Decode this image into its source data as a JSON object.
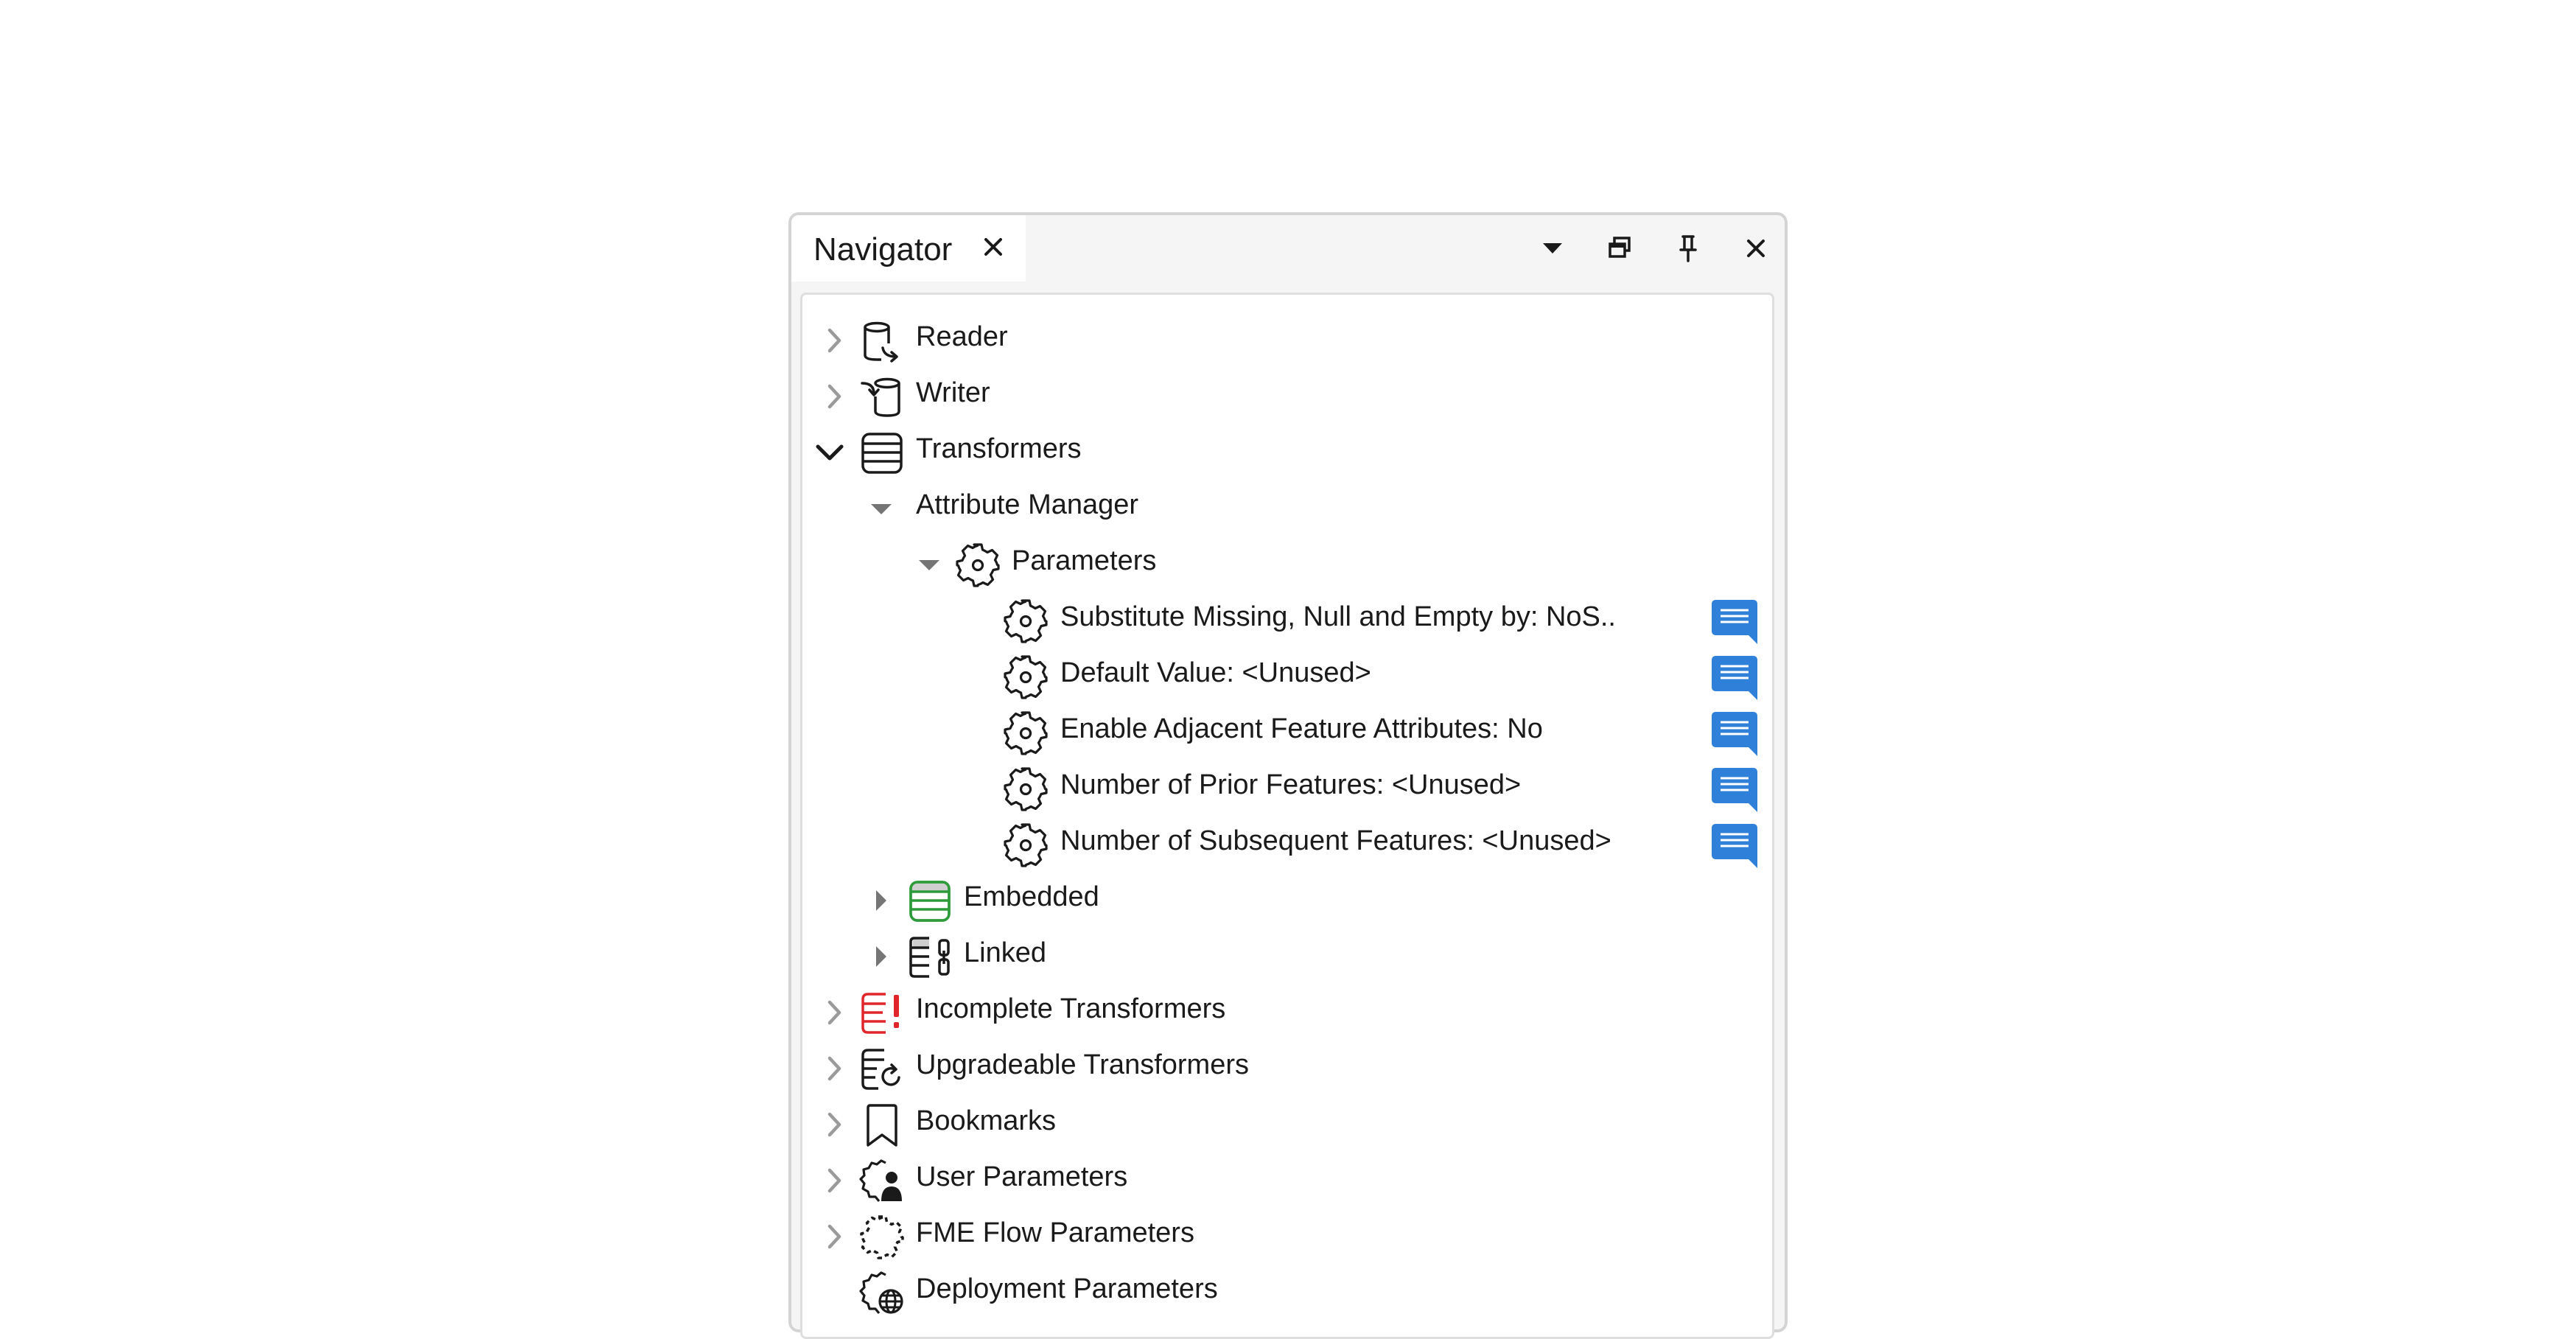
{
  "panel": {
    "tab_title": "Navigator",
    "toolbar": [
      "chevron-down-icon",
      "restore-icon",
      "pin-icon",
      "close-icon"
    ]
  },
  "tree": [
    {
      "label": "Reader",
      "icon": "reader-icon",
      "expander": "chevron-right",
      "expanded": false
    },
    {
      "label": "Writer",
      "icon": "writer-icon",
      "expander": "chevron-right",
      "expanded": false
    },
    {
      "label": "Transformers",
      "icon": "transformers-icon",
      "expander": "chevron-down",
      "expanded": true
    },
    {
      "label": "Attribute Manager",
      "expander": "triangle-down",
      "expanded": true
    },
    {
      "label": "Parameters",
      "icon": "gear-icon",
      "expander": "triangle-down",
      "expanded": true
    },
    {
      "label": "Substitute Missing, Null and Empty by: NoS..",
      "icon": "gear-icon",
      "annotation": "note-icon"
    },
    {
      "label": "Default Value: <Unused>",
      "icon": "gear-icon",
      "annotation": "note-icon"
    },
    {
      "label": "Enable Adjacent Feature Attributes: No",
      "icon": "gear-icon",
      "annotation": "note-icon"
    },
    {
      "label": "Number of Prior Features: <Unused>",
      "icon": "gear-icon",
      "annotation": "note-icon"
    },
    {
      "label": "Number of Subsequent Features: <Unused>",
      "icon": "gear-icon",
      "annotation": "note-icon"
    },
    {
      "label": "Embedded",
      "icon": "embedded-icon",
      "expander": "triangle-right",
      "expanded": false
    },
    {
      "label": "Linked",
      "icon": "linked-icon",
      "expander": "triangle-right",
      "expanded": false
    },
    {
      "label": "Incomplete Transformers",
      "icon": "incomplete-icon",
      "expander": "chevron-right",
      "expanded": false
    },
    {
      "label": "Upgradeable Transformers",
      "icon": "upgradeable-icon",
      "expander": "chevron-right",
      "expanded": false
    },
    {
      "label": "Bookmarks",
      "icon": "bookmark-icon",
      "expander": "chevron-right",
      "expanded": false
    },
    {
      "label": "User Parameters",
      "icon": "user-parameters-icon",
      "expander": "chevron-right",
      "expanded": false
    },
    {
      "label": "FME Flow Parameters",
      "icon": "flow-parameters-icon",
      "expander": "chevron-right",
      "expanded": false
    },
    {
      "label": "Deployment Parameters",
      "icon": "deployment-parameters-icon"
    }
  ],
  "colors": {
    "note_blue": "#2f80d8",
    "embedded_green": "#2e9b3a",
    "incomplete_red": "#e0262b",
    "chevron_gray": "#9a9a9a",
    "triangle_gray": "#757575"
  }
}
